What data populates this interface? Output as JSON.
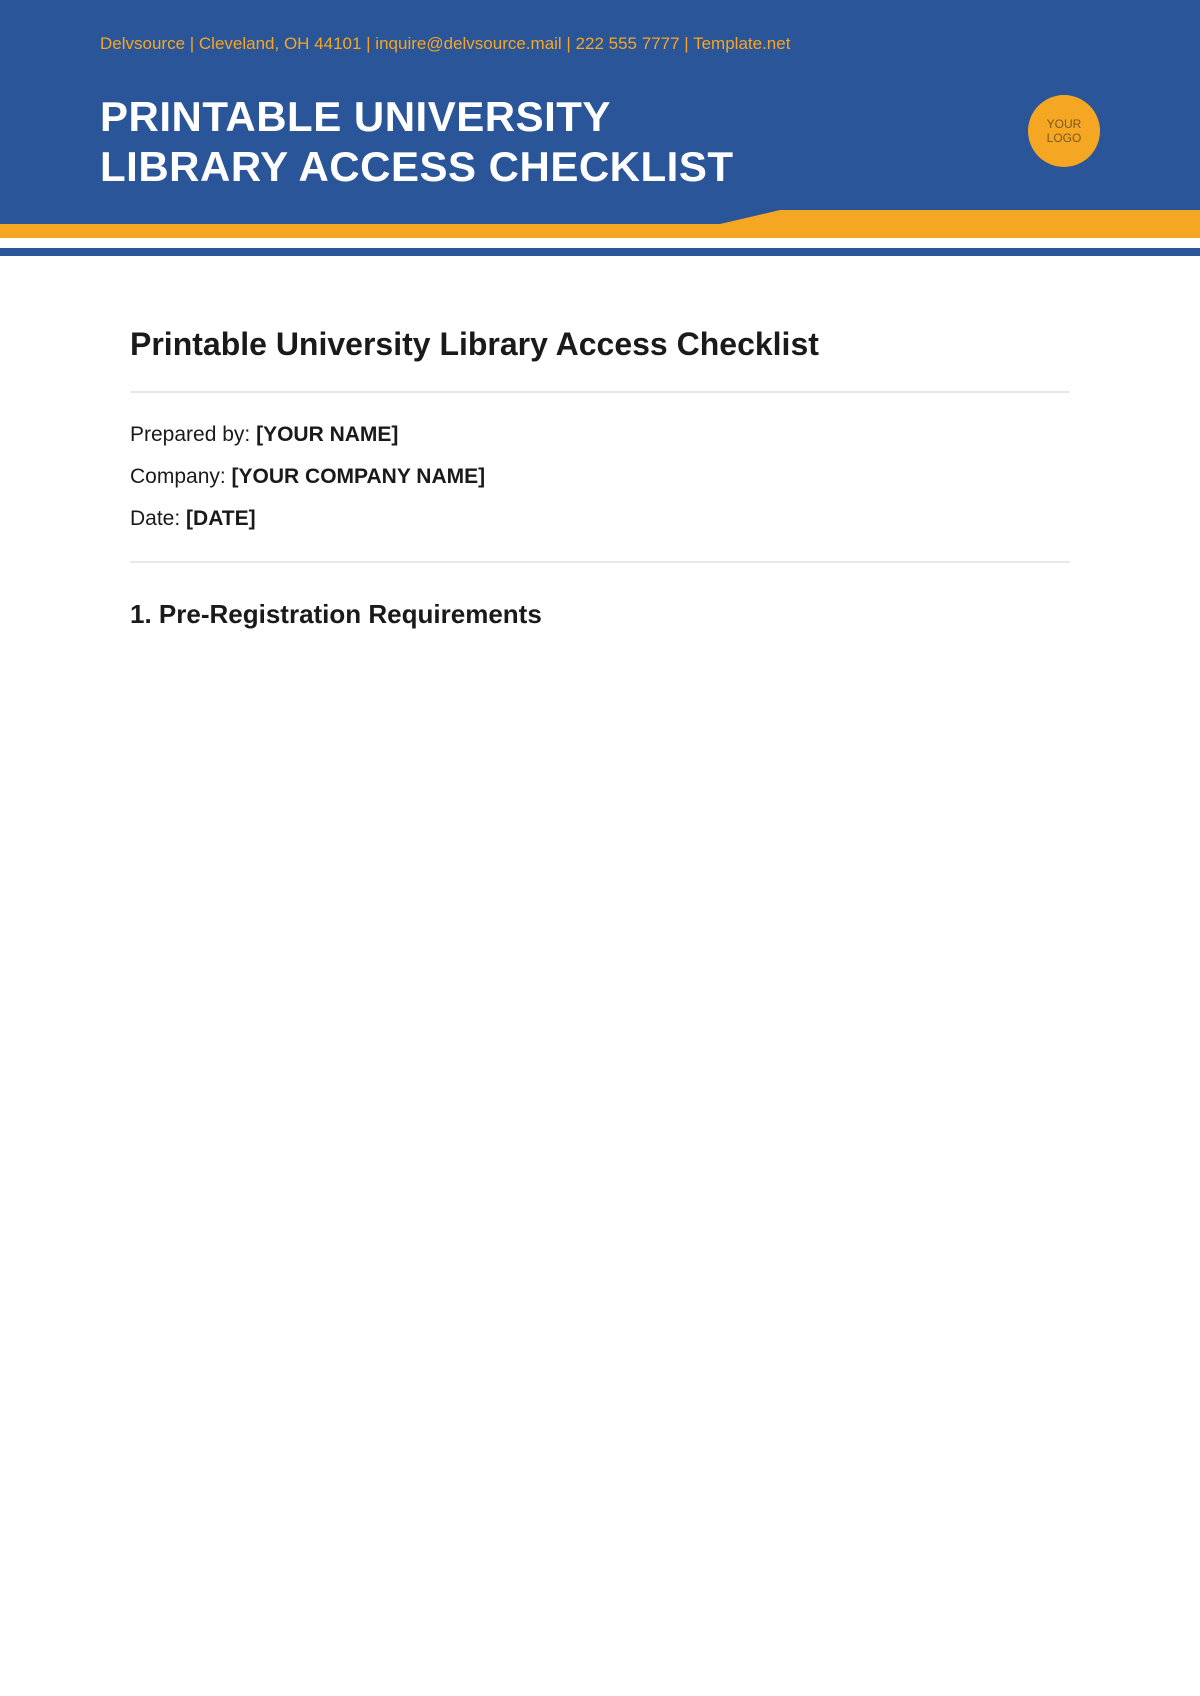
{
  "header": {
    "meta_line": "Delvsource | Cleveland, OH 44101 | inquire@delvsource.mail | 222 555 7777 | Template.net",
    "title_line1": "PRINTABLE UNIVERSITY",
    "title_line2": "LIBRARY ACCESS CHECKLIST",
    "logo_line1": "YOUR",
    "logo_line2": "LOGO"
  },
  "content": {
    "doc_title": "Printable University Library Access Checklist",
    "prepared_by_label": "Prepared by: ",
    "prepared_by_value": "[YOUR NAME]",
    "company_label": "Company: ",
    "company_value": "[YOUR COMPANY NAME]",
    "date_label": "Date: ",
    "date_value": "[DATE]",
    "section1_heading": "1. Pre-Registration Requirements"
  },
  "colors": {
    "blue": "#2a5598",
    "orange": "#f5a623"
  }
}
